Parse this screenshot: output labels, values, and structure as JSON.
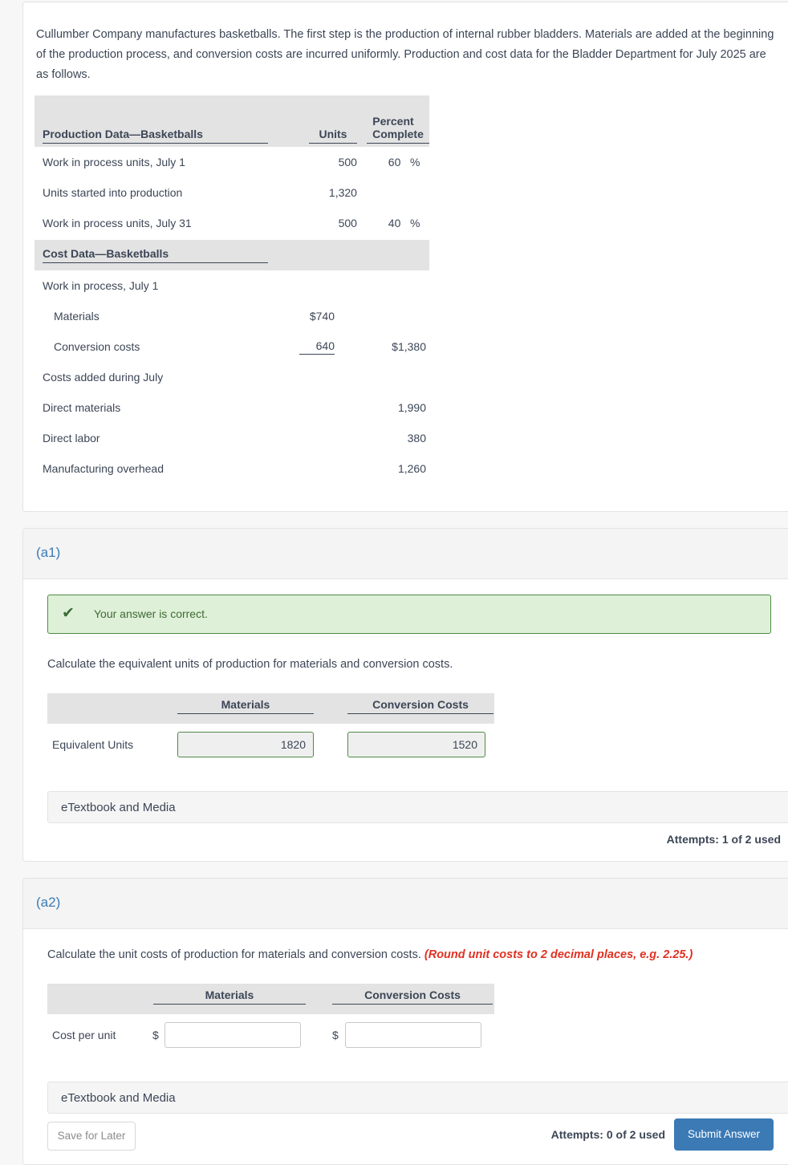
{
  "intro": {
    "paragraph": "Cullumber Company manufactures basketballs. The first step is the production of internal rubber bladders. Materials are added at the beginning of the production process, and conversion costs are incurred uniformly. Production and cost data for the Bladder Department for July 2025 are as follows."
  },
  "production_table": {
    "header": {
      "title": "Production Data—Basketballs",
      "units": "Units",
      "percent_line1": "Percent",
      "percent_line2": "Complete"
    },
    "rows": [
      {
        "label": "Work in process units, July 1",
        "units": "500",
        "percent": "60",
        "percent_symbol": "%"
      },
      {
        "label": "Units started into production",
        "units": "1,320",
        "percent": "",
        "percent_symbol": ""
      },
      {
        "label": "Work in process units, July 31",
        "units": "500",
        "percent": "40",
        "percent_symbol": "%"
      }
    ]
  },
  "cost_table": {
    "header": {
      "title": "Cost Data—Basketballs"
    },
    "rows": [
      {
        "label": "Work in process, July 1",
        "indent": false,
        "col1": "",
        "col2": "",
        "underline": false
      },
      {
        "label": "Materials",
        "indent": true,
        "col1": "$740",
        "col2": "",
        "underline": false
      },
      {
        "label": "Conversion costs",
        "indent": true,
        "col1": "640",
        "col2": "$1,380",
        "underline": true
      },
      {
        "label": "Costs added during July",
        "indent": false,
        "col1": "",
        "col2": "",
        "underline": false
      },
      {
        "label": "Direct materials",
        "indent": false,
        "col1": "",
        "col2": "1,990",
        "underline": false
      },
      {
        "label": "Direct labor",
        "indent": false,
        "col1": "",
        "col2": "380",
        "underline": false
      },
      {
        "label": "Manufacturing overhead",
        "indent": false,
        "col1": "",
        "col2": "1,260",
        "underline": false
      }
    ]
  },
  "part_a1": {
    "label": "(a1)",
    "alert": {
      "icon": "check-icon",
      "text": "Your answer is correct.",
      "background": "#dff0d8",
      "border": "#4f8a46",
      "text_color": "#3d6b34"
    },
    "prompt": "Calculate the equivalent units of production for materials and conversion costs.",
    "table": {
      "col_headers": [
        "Materials",
        "Conversion Costs"
      ],
      "row_label": "Equivalent Units",
      "values": [
        "1820",
        "1520"
      ]
    },
    "etextbook_label": "eTextbook and Media",
    "attempts": "Attempts: 1 of 2 used"
  },
  "part_a2": {
    "label": "(a2)",
    "prompt": "Calculate the unit costs of production for materials and conversion costs.",
    "prompt_note": "(Round unit costs to 2 decimal places, e.g. 2.25.)",
    "table": {
      "col_headers": [
        "Materials",
        "Conversion Costs"
      ],
      "row_label": "Cost per unit",
      "currency_symbol": "$",
      "values": [
        "",
        ""
      ]
    },
    "etextbook_label": "eTextbook and Media",
    "attempts": "Attempts: 0 of 2 used",
    "save_label": "Save for Later",
    "submit_label": "Submit Answer"
  },
  "colors": {
    "accent_blue": "#3b7ab5",
    "alert_green_bg": "#dff0d8",
    "alert_green_text": "#3d6b34",
    "note_red": "#e03021",
    "table_header_gray": "#e3e3e3",
    "text": "#3c4656"
  }
}
